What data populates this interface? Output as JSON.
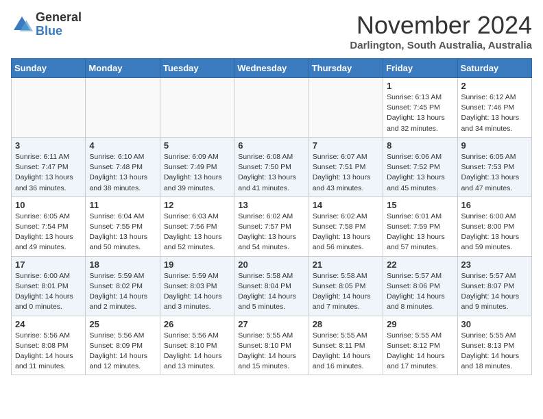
{
  "header": {
    "logo_general": "General",
    "logo_blue": "Blue",
    "month_title": "November 2024",
    "subtitle": "Darlington, South Australia, Australia"
  },
  "weekdays": [
    "Sunday",
    "Monday",
    "Tuesday",
    "Wednesday",
    "Thursday",
    "Friday",
    "Saturday"
  ],
  "weeks": [
    [
      {
        "day": "",
        "info": ""
      },
      {
        "day": "",
        "info": ""
      },
      {
        "day": "",
        "info": ""
      },
      {
        "day": "",
        "info": ""
      },
      {
        "day": "",
        "info": ""
      },
      {
        "day": "1",
        "info": "Sunrise: 6:13 AM\nSunset: 7:45 PM\nDaylight: 13 hours\nand 32 minutes."
      },
      {
        "day": "2",
        "info": "Sunrise: 6:12 AM\nSunset: 7:46 PM\nDaylight: 13 hours\nand 34 minutes."
      }
    ],
    [
      {
        "day": "3",
        "info": "Sunrise: 6:11 AM\nSunset: 7:47 PM\nDaylight: 13 hours\nand 36 minutes."
      },
      {
        "day": "4",
        "info": "Sunrise: 6:10 AM\nSunset: 7:48 PM\nDaylight: 13 hours\nand 38 minutes."
      },
      {
        "day": "5",
        "info": "Sunrise: 6:09 AM\nSunset: 7:49 PM\nDaylight: 13 hours\nand 39 minutes."
      },
      {
        "day": "6",
        "info": "Sunrise: 6:08 AM\nSunset: 7:50 PM\nDaylight: 13 hours\nand 41 minutes."
      },
      {
        "day": "7",
        "info": "Sunrise: 6:07 AM\nSunset: 7:51 PM\nDaylight: 13 hours\nand 43 minutes."
      },
      {
        "day": "8",
        "info": "Sunrise: 6:06 AM\nSunset: 7:52 PM\nDaylight: 13 hours\nand 45 minutes."
      },
      {
        "day": "9",
        "info": "Sunrise: 6:05 AM\nSunset: 7:53 PM\nDaylight: 13 hours\nand 47 minutes."
      }
    ],
    [
      {
        "day": "10",
        "info": "Sunrise: 6:05 AM\nSunset: 7:54 PM\nDaylight: 13 hours\nand 49 minutes."
      },
      {
        "day": "11",
        "info": "Sunrise: 6:04 AM\nSunset: 7:55 PM\nDaylight: 13 hours\nand 50 minutes."
      },
      {
        "day": "12",
        "info": "Sunrise: 6:03 AM\nSunset: 7:56 PM\nDaylight: 13 hours\nand 52 minutes."
      },
      {
        "day": "13",
        "info": "Sunrise: 6:02 AM\nSunset: 7:57 PM\nDaylight: 13 hours\nand 54 minutes."
      },
      {
        "day": "14",
        "info": "Sunrise: 6:02 AM\nSunset: 7:58 PM\nDaylight: 13 hours\nand 56 minutes."
      },
      {
        "day": "15",
        "info": "Sunrise: 6:01 AM\nSunset: 7:59 PM\nDaylight: 13 hours\nand 57 minutes."
      },
      {
        "day": "16",
        "info": "Sunrise: 6:00 AM\nSunset: 8:00 PM\nDaylight: 13 hours\nand 59 minutes."
      }
    ],
    [
      {
        "day": "17",
        "info": "Sunrise: 6:00 AM\nSunset: 8:01 PM\nDaylight: 14 hours\nand 0 minutes."
      },
      {
        "day": "18",
        "info": "Sunrise: 5:59 AM\nSunset: 8:02 PM\nDaylight: 14 hours\nand 2 minutes."
      },
      {
        "day": "19",
        "info": "Sunrise: 5:59 AM\nSunset: 8:03 PM\nDaylight: 14 hours\nand 3 minutes."
      },
      {
        "day": "20",
        "info": "Sunrise: 5:58 AM\nSunset: 8:04 PM\nDaylight: 14 hours\nand 5 minutes."
      },
      {
        "day": "21",
        "info": "Sunrise: 5:58 AM\nSunset: 8:05 PM\nDaylight: 14 hours\nand 7 minutes."
      },
      {
        "day": "22",
        "info": "Sunrise: 5:57 AM\nSunset: 8:06 PM\nDaylight: 14 hours\nand 8 minutes."
      },
      {
        "day": "23",
        "info": "Sunrise: 5:57 AM\nSunset: 8:07 PM\nDaylight: 14 hours\nand 9 minutes."
      }
    ],
    [
      {
        "day": "24",
        "info": "Sunrise: 5:56 AM\nSunset: 8:08 PM\nDaylight: 14 hours\nand 11 minutes."
      },
      {
        "day": "25",
        "info": "Sunrise: 5:56 AM\nSunset: 8:09 PM\nDaylight: 14 hours\nand 12 minutes."
      },
      {
        "day": "26",
        "info": "Sunrise: 5:56 AM\nSunset: 8:10 PM\nDaylight: 14 hours\nand 13 minutes."
      },
      {
        "day": "27",
        "info": "Sunrise: 5:55 AM\nSunset: 8:10 PM\nDaylight: 14 hours\nand 15 minutes."
      },
      {
        "day": "28",
        "info": "Sunrise: 5:55 AM\nSunset: 8:11 PM\nDaylight: 14 hours\nand 16 minutes."
      },
      {
        "day": "29",
        "info": "Sunrise: 5:55 AM\nSunset: 8:12 PM\nDaylight: 14 hours\nand 17 minutes."
      },
      {
        "day": "30",
        "info": "Sunrise: 5:55 AM\nSunset: 8:13 PM\nDaylight: 14 hours\nand 18 minutes."
      }
    ]
  ]
}
